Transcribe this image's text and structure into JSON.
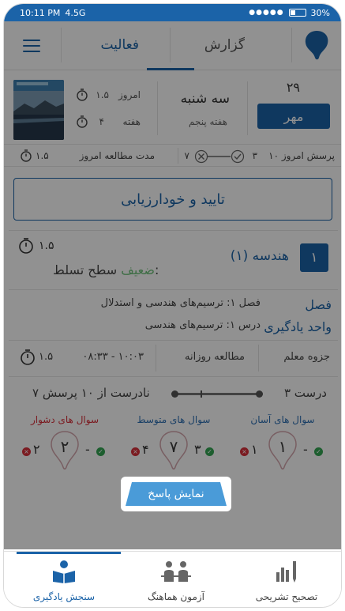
{
  "statusbar": {
    "time": "10:11 PM",
    "network": "4.5G",
    "battery": "30%"
  },
  "topnav": {
    "tab_report": "گزارش",
    "tab_activity": "فعالیت"
  },
  "date": {
    "day_number": "۲۹",
    "month": "مهر",
    "day_name": "سه شنبه",
    "week_name": "هفته پنجم"
  },
  "stats": {
    "today_label": "امروز",
    "today_value": "۱.۵",
    "week_label": "هفته",
    "week_value": "۴"
  },
  "infobar": {
    "today_questions": "۱۰ پرسش امروز",
    "correct_count": "۳",
    "wrong_count": "۷",
    "study_duration_label": "مدت مطالعه امروز",
    "study_duration_value": "۱.۵"
  },
  "confirm_button": "تایید و خودارزیابی",
  "lesson": {
    "number": "۱",
    "title": "هندسه (۱)",
    "timer": "۱.۵",
    "mastery_label": "سطح تسلط:",
    "mastery_value": "ضعیف",
    "chapter_label": "فصل",
    "chapter_text": "فصل ۱: ترسیم‌های هندسی و استدلال",
    "unit_label": "واحد یادگیری",
    "unit_text": "درس ۱: ترسیم‌های هندسی",
    "source": "جزوه معلم",
    "study_type": "مطالعه روزانه",
    "time_range": "۰۸:۳۳ - ۱۰:۰۳",
    "duration": "۱.۵",
    "correct_text": "۳ درست",
    "wrong_text": "۷ نادرست از ۱۰ پرسش"
  },
  "levels": [
    {
      "title": "سوال های آسان",
      "color": "#2d6fb3",
      "count": "۱",
      "ok": "-",
      "err": "۱"
    },
    {
      "title": "سوال های متوسط",
      "color": "#2d6fb3",
      "count": "۷",
      "ok": "۳",
      "err": "۴"
    },
    {
      "title": "سوال های دشوار",
      "color": "#d9303a",
      "count": "۲",
      "ok": "-",
      "err": "۲"
    }
  ],
  "show_answer_button": "نمایش پاسخ",
  "bottomnav": {
    "item_assessment": "سنجش یادگیری",
    "item_exam": "آزمون هماهنگ",
    "item_descriptive": "تصحیح تشریحی"
  },
  "colors": {
    "primary": "#1b63a8",
    "success": "#34a653",
    "danger": "#d9303a",
    "weak": "#6ec17a"
  }
}
